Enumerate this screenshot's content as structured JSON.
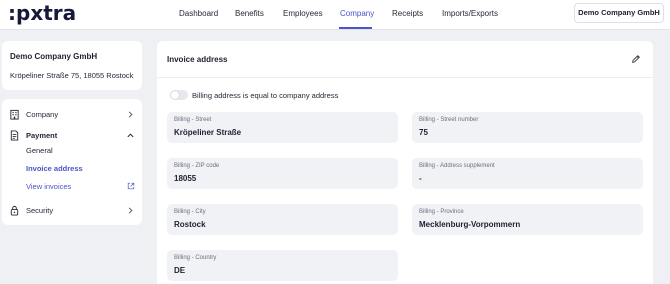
{
  "brand": {
    "logo_text_pre": ":p",
    "logo_text_x": "x",
    "logo_text_post": "tra"
  },
  "nav": {
    "items": [
      {
        "label": "Dashboard"
      },
      {
        "label": "Benefits"
      },
      {
        "label": "Employees"
      },
      {
        "label": "Company"
      },
      {
        "label": "Receipts"
      },
      {
        "label": "Imports/Exports"
      }
    ],
    "active": "Company",
    "company_button": "Demo Company GmbH"
  },
  "company_card": {
    "name": "Demo Company GmbH",
    "address": "Kröpeliner Straße 75, 18055 Rostock"
  },
  "menu": {
    "company": {
      "label": "Company",
      "icon": "building-icon",
      "chevron": "chevron-right-icon"
    },
    "payment": {
      "label": "Payment",
      "icon": "document-icon",
      "chevron": "chevron-up-icon",
      "sub_items": [
        {
          "label": "General"
        },
        {
          "label": "Invoice address"
        },
        {
          "label": "View invoices",
          "icon": "external-link-icon"
        }
      ]
    },
    "security": {
      "label": "Security",
      "icon": "lock-icon",
      "chevron": "chevron-right-icon"
    }
  },
  "main": {
    "title": "Invoice address",
    "edit_icon": "pencil-icon",
    "toggle_label": "Billing address is equal to company address",
    "toggle_on": false,
    "fields": [
      {
        "label": "Billing - Street",
        "value": "Kröpeliner Straße"
      },
      {
        "label": "Billing - Street number",
        "value": "75"
      },
      {
        "label": "Billing - ZIP code",
        "value": "18055"
      },
      {
        "label": "Billing - Address supplement",
        "value": "-"
      },
      {
        "label": "Billing - City",
        "value": "Rostock"
      },
      {
        "label": "Billing - Province",
        "value": "Mecklenburg-Vorpommern"
      },
      {
        "label": "Billing - Country",
        "value": "DE"
      }
    ]
  },
  "colors": {
    "accent": "#4b55c8",
    "background": "#eef0f4",
    "field_bg": "#f1f2f6",
    "text": "#1d2030"
  }
}
